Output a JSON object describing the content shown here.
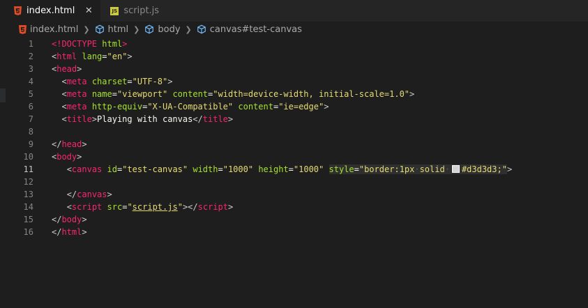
{
  "tabs": [
    {
      "label": "index.html",
      "icon": "html5-icon",
      "active": true,
      "close": "✕"
    },
    {
      "label": "script.js",
      "icon": "js-icon",
      "active": false,
      "icon_text": "JS"
    }
  ],
  "breadcrumb": {
    "items": [
      "index.html",
      "html",
      "body",
      "canvas#test-canvas"
    ]
  },
  "editor": {
    "line_numbers": [
      "1",
      "2",
      "3",
      "4",
      "5",
      "6",
      "7",
      "8",
      "9",
      "10",
      "11",
      "12",
      "13",
      "14",
      "15",
      "16"
    ],
    "current_line": "11",
    "code": {
      "l1": {
        "open": "<",
        "doctype": "!DOCTYPE",
        "sp": " ",
        "html": "html",
        "close": ">"
      },
      "l2": {
        "tag": "html",
        "attr": "lang",
        "val": "\"en\""
      },
      "l3": {
        "tag": "head"
      },
      "l4": {
        "tag": "meta",
        "attr": "charset",
        "val": "\"UTF-8\""
      },
      "l5": {
        "tag": "meta",
        "attr1": "name",
        "val1": "\"viewport\"",
        "attr2": "content",
        "val2": "\"width=device-width, initial-scale=1.0\""
      },
      "l6": {
        "tag": "meta",
        "attr1": "http-equiv",
        "val1": "\"X-UA-Compatible\"",
        "attr2": "content",
        "val2": "\"ie=edge\""
      },
      "l7": {
        "tag": "title",
        "text": "Playing with canvas"
      },
      "l9": {
        "tag": "head"
      },
      "l10": {
        "tag": "body"
      },
      "l11": {
        "tag": "canvas",
        "attr1": "id",
        "val1": "\"test-canvas\"",
        "attr2": "width",
        "val2": "\"1000\"",
        "attr3": "height",
        "val3": "\"1000\"",
        "attr4": "style",
        "val4a": "\"border:1px",
        "val4b": "solid",
        "val4c": "#d3d3d3;\""
      },
      "l13": {
        "tag": "canvas"
      },
      "l14": {
        "tag": "script",
        "attr": "src",
        "val_open": "\"",
        "val_link": "script.js",
        "val_close": "\"",
        "end_tag": "script"
      },
      "l15": {
        "tag": "body"
      },
      "l16": {
        "tag": "html"
      }
    }
  },
  "colors": {
    "background": "#1e1e1e",
    "tag": "#f92672",
    "attribute": "#a6e22e",
    "string": "#e6db74",
    "swatch": "#d3d3d3"
  }
}
